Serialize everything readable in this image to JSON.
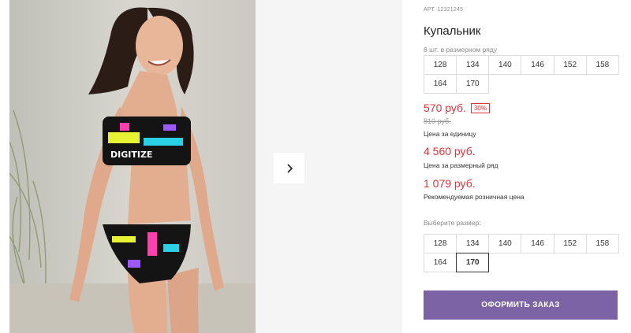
{
  "gallery": {
    "image_alt": "Девочка в купальнике",
    "next_icon": "chevron-right-icon"
  },
  "product": {
    "sku": "АРТ. 12321245",
    "title": "Купальник",
    "row_sizes_label": "8 шт. в размерном ряду",
    "row_sizes": [
      "128",
      "134",
      "140",
      "146",
      "152",
      "158",
      "164",
      "170"
    ],
    "price": "570 руб.",
    "discount": "30%",
    "old_price": "810 руб.",
    "unit_caption": "Цена за единицу",
    "row_price": "4 560 руб.",
    "row_caption": "Цена за размерный ряд",
    "retail_price": "1 079 руб.",
    "retail_caption": "Рекомендуемая розничная цена",
    "choose_label": "Выберите размер:",
    "choose_sizes": [
      "128",
      "134",
      "140",
      "146",
      "152",
      "158",
      "164",
      "170"
    ],
    "selected_size": "170"
  },
  "actions": {
    "order_label": "ОФОРМИТЬ ЗАКАЗ"
  },
  "colors": {
    "accent": "#7c63a5",
    "price": "#e0343a"
  }
}
